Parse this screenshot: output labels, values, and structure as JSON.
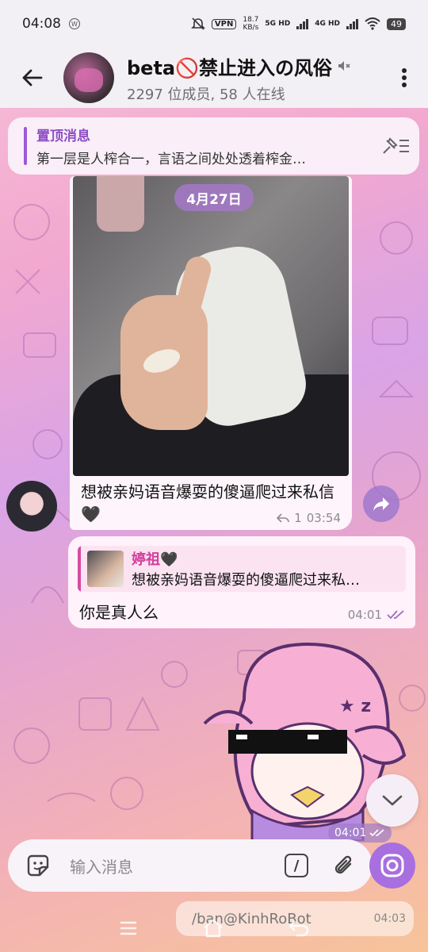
{
  "status_bar": {
    "time": "04:08",
    "app_badge": "W",
    "vpn": "VPN",
    "speed_value": "18.7",
    "speed_unit": "KB/s",
    "net1": "5G HD",
    "net2": "4G HD",
    "battery": "49"
  },
  "header": {
    "title": "beta🚫禁止进入の风俗",
    "subtitle": "2297 位成员, 58 人在线",
    "back_icon": "arrow-left-icon",
    "menu_icon": "more-vert-icon",
    "mute_icon": "speaker-muted-icon"
  },
  "pinned": {
    "label": "置顶消息",
    "text": "第一层是人榨合一，言语之间处处透着榨金…",
    "icon": "pin-list-icon"
  },
  "messages": {
    "date_chip": "4月27日",
    "photo_caption": "想被亲妈语音爆耍的傻逼爬过来私信🖤",
    "photo_reply_count": "1",
    "photo_time": "03:54",
    "reply": {
      "quote_name": "婷祖🖤",
      "quote_text": "想被亲妈语音爆耍的傻逼爬过来私…",
      "text": "你是真人么",
      "time": "04:01"
    },
    "sticker_time": "04:01",
    "ghost_text": "/ban@KinhRoBot",
    "ghost_time": "04:03"
  },
  "input": {
    "placeholder": "输入消息",
    "command_symbol": "/"
  },
  "colors": {
    "accent": "#9c5ad6",
    "quote_name": "#d33f9e",
    "camera_button": "#a86fe0"
  }
}
